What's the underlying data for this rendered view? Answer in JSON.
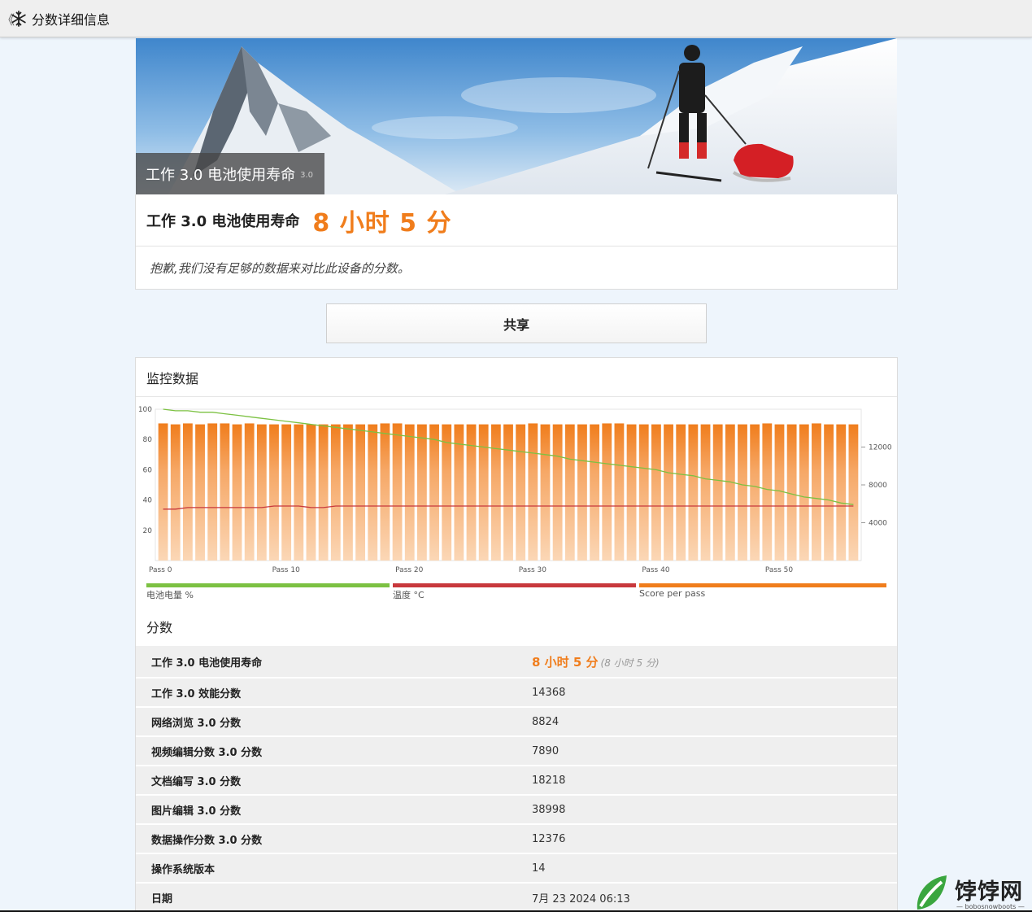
{
  "header": {
    "back_glyph": "《",
    "app_icon": "snowflake-icon",
    "title": "分数详细信息"
  },
  "hero": {
    "caption": "工作 3.0 电池使用寿命",
    "version": "3.0"
  },
  "score": {
    "label": "工作 3.0 电池使用寿命",
    "value": "8 小时 5 分",
    "note": "抱歉,我们没有足够的数据来对比此设备的分数。"
  },
  "share_label": "共享",
  "monitoring": {
    "title": "监控数据",
    "legend": [
      {
        "label": "电池电量 %",
        "color": "#7cc142"
      },
      {
        "label": "温度 °C",
        "color": "#c8383c"
      },
      {
        "label": "Score per pass",
        "color": "#f07d1c"
      }
    ]
  },
  "chart_data": {
    "type": "bar",
    "passes": 57,
    "x_ticks": [
      "Pass 0",
      "Pass 10",
      "Pass 20",
      "Pass 30",
      "Pass 40",
      "Pass 50"
    ],
    "y_left_ticks": [
      "100",
      "80",
      "60",
      "40",
      "20"
    ],
    "y_left_range": [
      0,
      100
    ],
    "y_right_ticks": [
      "12000",
      "8000",
      "4000"
    ],
    "y_right_range": [
      0,
      16000
    ],
    "series": [
      {
        "name": "Score per pass",
        "axis": "right",
        "values": [
          14500,
          14400,
          14500,
          14400,
          14500,
          14500,
          14400,
          14500,
          14400,
          14400,
          14400,
          14400,
          14400,
          14400,
          14400,
          14400,
          14400,
          14400,
          14500,
          14500,
          14400,
          14400,
          14400,
          14400,
          14400,
          14400,
          14400,
          14400,
          14400,
          14400,
          14500,
          14400,
          14400,
          14400,
          14400,
          14400,
          14500,
          14500,
          14400,
          14400,
          14400,
          14400,
          14400,
          14400,
          14400,
          14400,
          14400,
          14400,
          14400,
          14500,
          14400,
          14400,
          14400,
          14500,
          14400,
          14400,
          14400
        ]
      },
      {
        "name": "电池电量 %",
        "axis": "left",
        "values": [
          100,
          99,
          99,
          98,
          98,
          97,
          96,
          95,
          94,
          93,
          92,
          91,
          90,
          89,
          88,
          87,
          86,
          85,
          84,
          83,
          82,
          81,
          80,
          78,
          77,
          76,
          75,
          74,
          73,
          72,
          71,
          70,
          69,
          67,
          66,
          65,
          64,
          63,
          62,
          61,
          60,
          58,
          57,
          56,
          54,
          53,
          52,
          50,
          49,
          47,
          46,
          44,
          42,
          41,
          40,
          38,
          37
        ]
      },
      {
        "name": "温度 °C",
        "axis": "left",
        "values": [
          34,
          34,
          35,
          35,
          35,
          35,
          35,
          35,
          35,
          36,
          36,
          36,
          35,
          35,
          36,
          36,
          36,
          36,
          36,
          36,
          36,
          36,
          36,
          36,
          36,
          36,
          36,
          36,
          36,
          36,
          36,
          36,
          36,
          36,
          36,
          36,
          36,
          36,
          36,
          36,
          36,
          36,
          36,
          36,
          36,
          36,
          36,
          36,
          36,
          36,
          36,
          36,
          36,
          36,
          36,
          36,
          36
        ]
      }
    ]
  },
  "scores": {
    "title": "分数",
    "rows": [
      {
        "key": "工作 3.0 电池使用寿命",
        "value": "8 小时 5 分",
        "sub": "(8 小时 5 分)"
      },
      {
        "key": "工作 3.0 效能分数",
        "value": "14368"
      },
      {
        "key": "网络浏览 3.0 分数",
        "value": "8824"
      },
      {
        "key": "视频编辑分数 3.0 分数",
        "value": "7890"
      },
      {
        "key": "文档编写 3.0 分数",
        "value": "18218"
      },
      {
        "key": "图片编辑 3.0 分数",
        "value": "38998"
      },
      {
        "key": "数据操作分数 3.0 分数",
        "value": "12376"
      },
      {
        "key": "操作系统版本",
        "value": "14"
      },
      {
        "key": "日期",
        "value": "7月 23 2024 06:13"
      }
    ]
  },
  "watermark": {
    "text": "饽饽网",
    "sub": "— bobosnowboots —"
  }
}
